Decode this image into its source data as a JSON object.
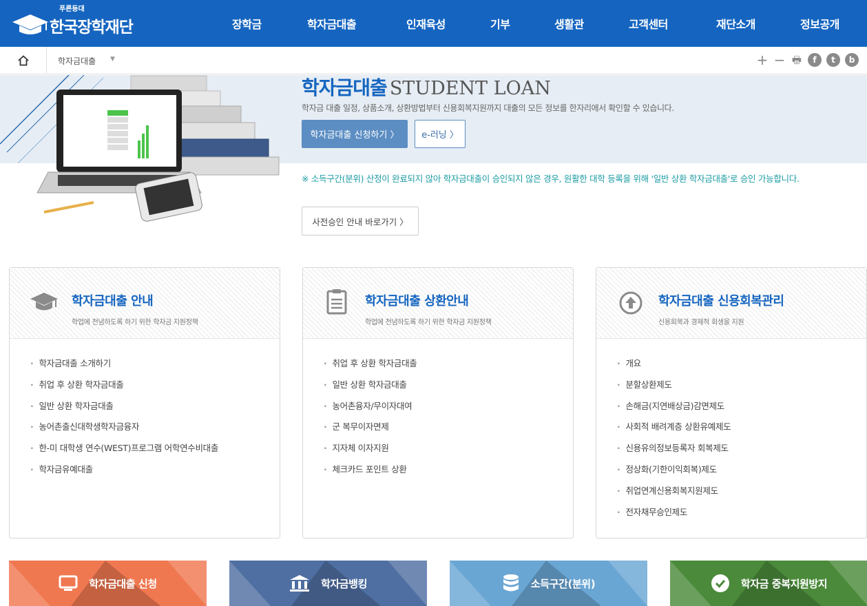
{
  "header": {
    "logo_small": "푸른등대",
    "logo_text": "한국장학재단",
    "nav": [
      "장학금",
      "학자금대출",
      "인재육성",
      "기부",
      "생활관",
      "고객센터",
      "재단소개",
      "정보공개"
    ]
  },
  "breadcrumb": {
    "current": "학자금대출"
  },
  "tools": {
    "zoom_in": "+",
    "zoom_out": "−",
    "print": "🖶",
    "facebook": "f",
    "twitter": "t",
    "blog": "b"
  },
  "hero": {
    "title_ko": "학자금대출",
    "title_en": "STUDENT LOAN",
    "description": "학자금 대출 일정, 상품소개, 상환방법부터 신용회복지원까지 대출의 모든 정보를 한자리에서 확인할 수 있습니다.",
    "apply_button": "학자금대출 신청하기 〉",
    "elearning_button": "e-러닝 〉",
    "notice": "※ 소득구간(분위) 산정이 완료되지 않아 학자금대출이 승인되지 않은 경우, 원활한 대학 등록을 위해 '일반 상환 학자금대출'로 승인 가능합니다.",
    "pre_approval_button": "사전승인 안내 바로가기 〉"
  },
  "cards": [
    {
      "title": "학자금대출 안내",
      "subtitle": "학업에 전념하도록 하기 위한 학자금 지원정책",
      "items": [
        "학자금대출 소개하기",
        "취업 후 상환 학자금대출",
        "일반 상환 학자금대출",
        "농어촌출신대학생학자금융자",
        "한-미 대학생 연수(WEST)프로그램 어학연수비대출",
        "학자금유예대출"
      ]
    },
    {
      "title": "학자금대출 상환안내",
      "subtitle": "학업에 전념하도록 하기 위한 학자금 지원정책",
      "items": [
        "취업 후 상환 학자금대출",
        "일반 상환 학자금대출",
        "농어촌융자/무이자대여",
        "군 복무이자면제",
        "지자체 이자지원",
        "체크카드 포인트 상환"
      ]
    },
    {
      "title": "학자금대출 신용회복관리",
      "subtitle": "신용회복과 경제적 회생을 지원",
      "items": [
        "개요",
        "분할상환제도",
        "손해금(지연배상금)감면제도",
        "사회적 배려계층 상환유예제도",
        "신용유의정보등록자 회복제도",
        "정상화(기한이익회복)제도",
        "취업연계신용회복지원제도",
        "전자채무승인제도"
      ]
    }
  ],
  "tiles": [
    {
      "label": "학자금대출 신청",
      "color": "#f07850"
    },
    {
      "label": "학자금뱅킹",
      "color": "#4f6fa2"
    },
    {
      "label": "소득구간(분위)",
      "color": "#6aa6d4"
    },
    {
      "label": "학자금 중복지원방지",
      "color": "#4a8a3a"
    }
  ],
  "colors": {
    "brand_blue": "#1565c0",
    "notice_teal": "#1a9ba3"
  }
}
